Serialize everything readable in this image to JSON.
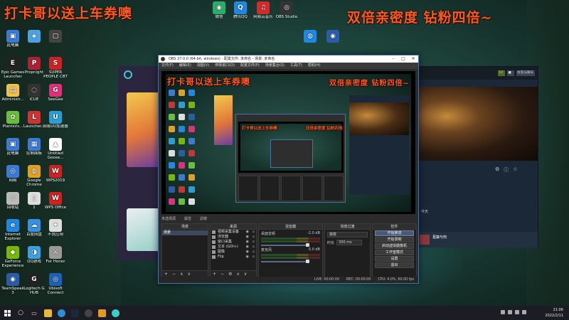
{
  "overlay": {
    "main_text": "打卡哥以送上车券噢",
    "right_text": "双倍亲密度 钻粉四倍~",
    "obs_text": "打卡哥以送上车券噢",
    "obs_right_text": "双倍亲密度 钻粉四倍~",
    "nested_left": "打卡哥以送上车券噢",
    "nested_right": "双倍亲密度 钻粉四倍"
  },
  "desktop_icons_col1": [
    {
      "label": "此电脑",
      "color": "#3a7bd5",
      "glyph": "▣"
    },
    {
      "label": "Epic Games Launcher",
      "color": "#222222",
      "glyph": "E"
    },
    {
      "label": "Administr...",
      "color": "#f0c24a",
      "glyph": "▤"
    },
    {
      "label": "PlantsVs...",
      "color": "#6abf3a",
      "glyph": "✿"
    },
    {
      "label": "此电脑",
      "color": "#3a7bd5",
      "glyph": "▣"
    },
    {
      "label": "网络",
      "color": "#3a7bd5",
      "glyph": "◎"
    },
    {
      "label": "回收站",
      "color": "#bbbbbb",
      "glyph": "♲"
    },
    {
      "label": "Internet Explorer",
      "color": "#1e88e5",
      "glyph": "e"
    },
    {
      "label": "GeForce Experience",
      "color": "#76b900",
      "glyph": "◆"
    },
    {
      "label": "TeamSpeak 3",
      "color": "#2a5ca8",
      "glyph": "◉"
    }
  ],
  "desktop_icons_col2": [
    {
      "label": "",
      "color": "#4aa3e0",
      "glyph": "◈"
    },
    {
      "label": "Propnight",
      "color": "#aa2233",
      "glyph": "P"
    },
    {
      "label": "iCUE",
      "color": "#333333",
      "glyph": "◌"
    },
    {
      "label": "Launcher...",
      "color": "#cc3333",
      "glyph": "L"
    },
    {
      "label": "控制面板",
      "color": "#3a7bd5",
      "glyph": "▦"
    },
    {
      "label": "Google Chrome",
      "color": "#e0a020",
      "glyph": "◍"
    },
    {
      "label": "1",
      "color": "#dddddd",
      "glyph": "▯"
    },
    {
      "label": "百度网盘",
      "color": "#3a8fe0",
      "glyph": "☁"
    },
    {
      "label": "QQ游戏",
      "color": "#3aa0e0",
      "glyph": "◑"
    },
    {
      "label": "Logitech G HUB",
      "color": "#222222",
      "glyph": "G"
    }
  ],
  "desktop_icons_col3": [
    {
      "label": "",
      "color": "#444444",
      "glyph": "▢"
    },
    {
      "label": "SUPER PEOPLE CBT",
      "color": "#cc2222",
      "glyph": "S"
    },
    {
      "label": "SeeGee",
      "color": "#e0307a",
      "glyph": "G"
    },
    {
      "label": "网易UU加速器",
      "color": "#2a9fd6",
      "glyph": "U"
    },
    {
      "label": "Untitled Goose...",
      "color": "#ffffff",
      "glyph": "▲"
    },
    {
      "label": "WPS2019",
      "color": "#cc2222",
      "glyph": "W"
    },
    {
      "label": "WPS Office",
      "color": "#cc2222",
      "glyph": "W"
    },
    {
      "label": "不良应用",
      "color": "#dddddd",
      "glyph": "✦"
    },
    {
      "label": "For Honor",
      "color": "#999999",
      "glyph": "⚔"
    },
    {
      "label": "Ubisoft Connect",
      "color": "#1e5fb8",
      "glyph": "◎"
    }
  ],
  "desktop_icons_top": [
    {
      "label": "微信",
      "color": "#2aae67",
      "glyph": "◉"
    },
    {
      "label": "腾讯QQ",
      "color": "#1e88e5",
      "glyph": "Q"
    },
    {
      "label": "网易云音乐",
      "color": "#d22b2b",
      "glyph": "♫"
    },
    {
      "label": "OBS Studio",
      "color": "#333333",
      "glyph": "◎"
    },
    {
      "label": "",
      "color": "#1e88e5",
      "glyph": "◍"
    },
    {
      "label": "",
      "color": "#2a5ca8",
      "glyph": "◉"
    }
  ],
  "obs": {
    "title": "OBS 27.0.0 (64-bit, windows) - 配置文件: 未命名 - 场景: 未命名",
    "menu": [
      "文件(F)",
      "编辑(E)",
      "视图(V)",
      "停靠窗口(D)",
      "配置文件(P)",
      "场景集合(S)",
      "工具(T)",
      "帮助(H)"
    ],
    "sep_bar": [
      "未选择源",
      "属性",
      "滤镜"
    ],
    "scenes": {
      "title": "场景",
      "items": [
        "场景"
      ]
    },
    "sources": {
      "title": "来源",
      "items": [
        "视频采集设备",
        "浏览器",
        "窗口采集",
        "文本 (GDI+)",
        "图像",
        "Flip"
      ]
    },
    "mixer": {
      "title": "混音器",
      "channels": [
        {
          "name": "桌面音频",
          "db": "-2.0 dB"
        },
        {
          "name": "麦克风",
          "db": "0.0 dB"
        }
      ]
    },
    "transitions": {
      "title": "场景过渡",
      "type": "渐变",
      "duration_label": "时长",
      "duration": "300 ms"
    },
    "controls": {
      "title": "控件",
      "buttons": [
        "开始推流",
        "开始录制",
        "启动虚拟摄像机",
        "工作室模式",
        "设置",
        "退出"
      ]
    },
    "status": {
      "live": "LIVE: 00:00:00",
      "rec": "REC: 00:00:00",
      "cpu": "CPU: 4.0%, 60.00 fps"
    }
  },
  "steam": {
    "friends_label": "好友与聊天",
    "chip1": "17",
    "chip2": "",
    "bottom_text": "今天",
    "bottom_title": "葛藤与肉"
  },
  "taskbar": {
    "time": "21:06",
    "date": "2022/2/11"
  }
}
